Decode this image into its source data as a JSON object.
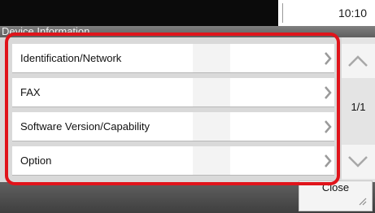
{
  "status": {
    "time": "10:10"
  },
  "screen": {
    "title": "Device Information"
  },
  "menu": {
    "items": [
      {
        "label": "Identification/Network"
      },
      {
        "label": "FAX"
      },
      {
        "label": "Software Version/Capability"
      },
      {
        "label": "Option"
      }
    ]
  },
  "pager": {
    "indicator": "1/1"
  },
  "footer": {
    "close_label": "Close"
  },
  "colors": {
    "highlight": "#e0141b",
    "status_bar": "#0b0b0b"
  },
  "icons": {
    "row_arrow": "chevron-right-icon",
    "scroll_up": "chevron-up-icon",
    "scroll_down": "chevron-down-icon"
  }
}
